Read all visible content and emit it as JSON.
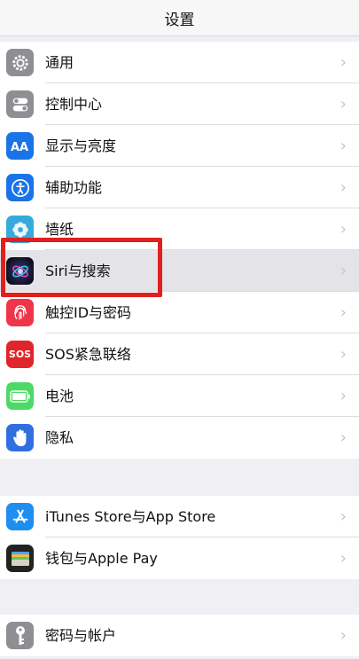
{
  "header": {
    "title": "设置"
  },
  "groups": [
    {
      "items": [
        {
          "label": "通用",
          "icon": "gear-icon",
          "color": "#8e8e93"
        },
        {
          "label": "控制中心",
          "icon": "toggles-icon",
          "color": "#8e8e93"
        },
        {
          "label": "显示与亮度",
          "icon": "text-size-icon",
          "color": "#1a73e8"
        },
        {
          "label": "辅助功能",
          "icon": "accessibility-icon",
          "color": "#1a73e8"
        },
        {
          "label": "墙纸",
          "icon": "flower-icon",
          "color": "#37aadc"
        },
        {
          "label": "Siri与搜索",
          "icon": "siri-icon",
          "color": "#1c1c3a"
        },
        {
          "label": "触控ID与密码",
          "icon": "fingerprint-icon",
          "color": "#f0354b"
        },
        {
          "label": "SOS紧急联络",
          "icon": "sos-icon",
          "color": "#e0252c",
          "icon_text": "SOS"
        },
        {
          "label": "电池",
          "icon": "battery-icon",
          "color": "#4cd964"
        },
        {
          "label": "隐私",
          "icon": "hand-icon",
          "color": "#2f6fe0"
        }
      ]
    },
    {
      "items": [
        {
          "label": "iTunes Store与App Store",
          "icon": "app-store-icon",
          "color": "#1e8ef0"
        },
        {
          "label": "钱包与Apple Pay",
          "icon": "wallet-icon",
          "color": "#222222"
        }
      ]
    },
    {
      "items": [
        {
          "label": "密码与帐户",
          "icon": "key-icon",
          "color": "#8e8e93"
        }
      ]
    }
  ],
  "highlighted_item": "Siri与搜索",
  "chevron": "›"
}
